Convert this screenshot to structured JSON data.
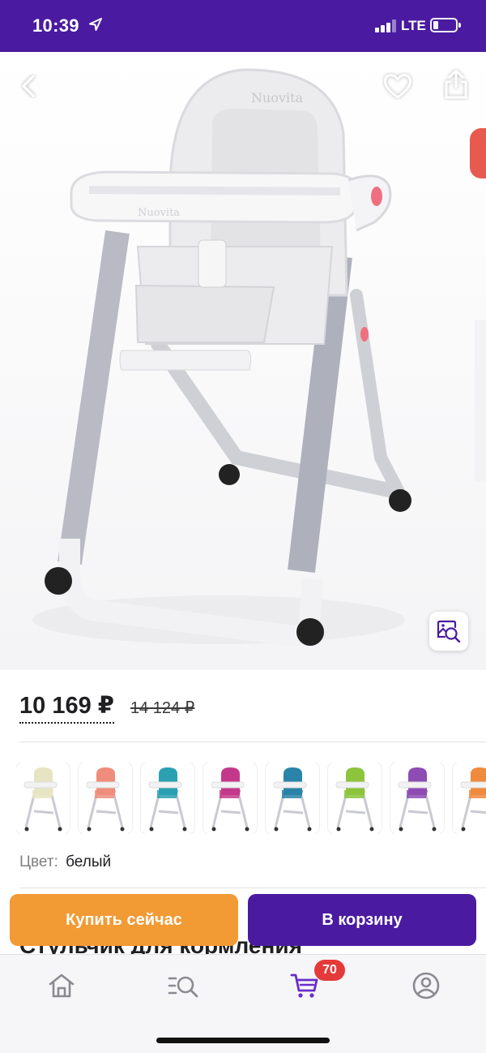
{
  "status_bar": {
    "time": "10:39",
    "network": "LTE",
    "icons": [
      "location-arrow-icon",
      "signal-bars-icon",
      "battery-icon"
    ]
  },
  "gallery": {
    "brand_mark": "Nuovita",
    "icons": [
      "back-arrow-icon",
      "heart-icon",
      "share-icon",
      "image-search-icon"
    ]
  },
  "price": {
    "current": "10 169 ₽",
    "old": "14 124 ₽"
  },
  "color_options": [
    {
      "color": "#e6e4c2"
    },
    {
      "color": "#ef8c7c"
    },
    {
      "color": "#2aa0b2"
    },
    {
      "color": "#c4388c"
    },
    {
      "color": "#2a83a8"
    },
    {
      "color": "#8cc43c"
    },
    {
      "color": "#8c4cb4"
    },
    {
      "color": "#f08a3c"
    }
  ],
  "color": {
    "label": "Цвет:",
    "value": "белый"
  },
  "product_title_partial": "Стульчик для кормления",
  "actions": {
    "buy_now": "Купить сейчас",
    "add_to_cart": "В корзину"
  },
  "tabbar": {
    "cart_count": "70",
    "icons": [
      "home-icon",
      "catalog-search-icon",
      "cart-icon",
      "profile-icon"
    ]
  },
  "colors": {
    "brand_purple": "#4a1ba0",
    "buy_orange": "#f29a34",
    "badge_red": "#e43a3a"
  }
}
